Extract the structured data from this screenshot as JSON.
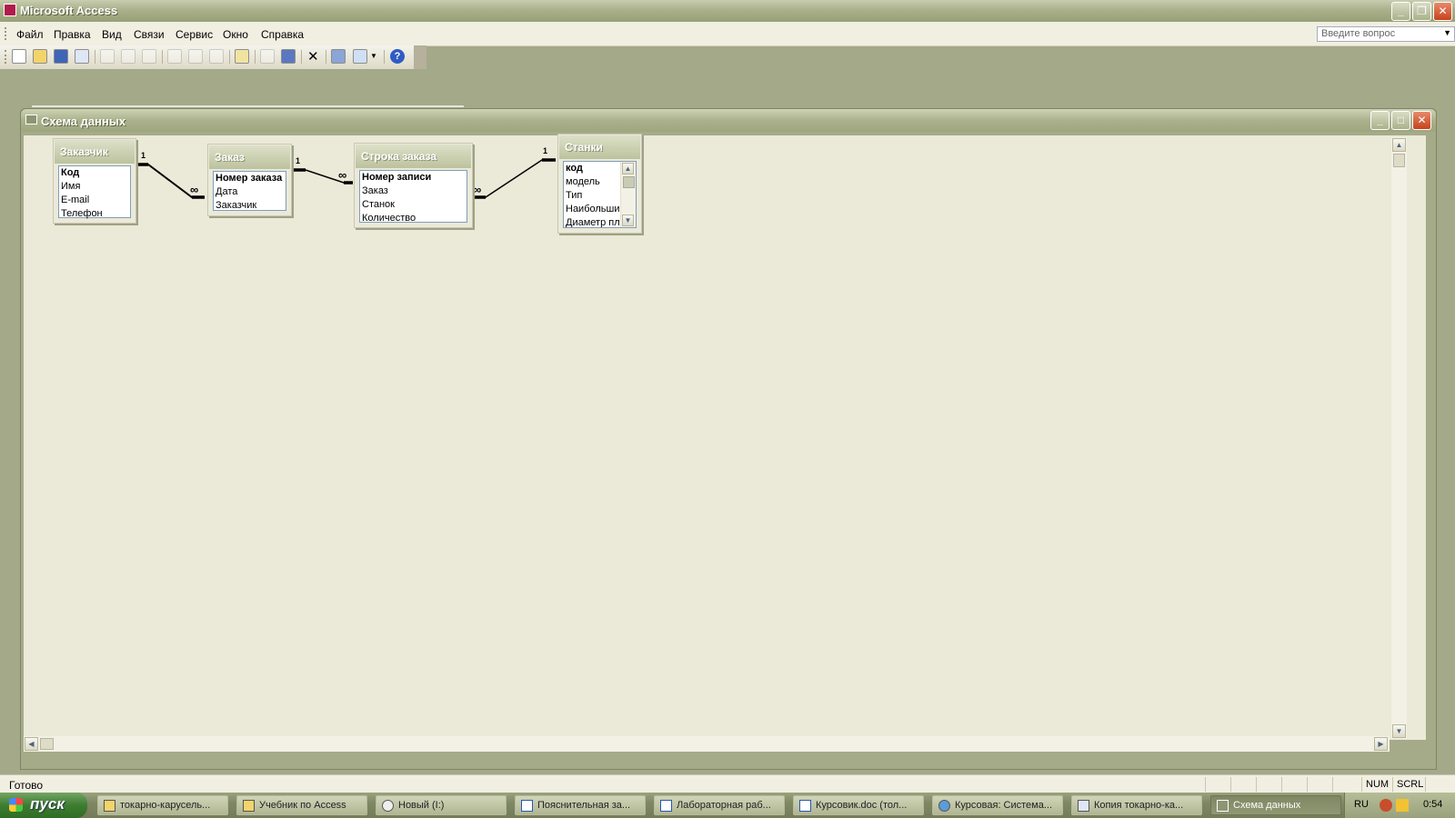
{
  "app": {
    "title": "Microsoft Access"
  },
  "menu": [
    "Файл",
    "Правка",
    "Вид",
    "Связи",
    "Сервис",
    "Окно",
    "Справка"
  ],
  "help_box": {
    "placeholder": "Введите вопрос"
  },
  "toolbar_icons": [
    "new-icon",
    "open-icon",
    "save-icon",
    "print-preview-icon",
    "print-icon",
    "preview-icon",
    "spelling-icon",
    "cut-icon",
    "copy-icon",
    "paste-icon",
    "show-table-icon",
    "direct-relationships-icon",
    "all-relationships-icon",
    "delete-icon",
    "database-window-icon",
    "new-object-icon",
    "help-icon"
  ],
  "window": {
    "title": "Схема данных"
  },
  "tables": [
    {
      "name": "Заказчик",
      "fields": [
        "Код",
        "Имя",
        "E-mail",
        "Телефон"
      ],
      "keys": [
        0
      ]
    },
    {
      "name": "Заказ",
      "fields": [
        "Номер заказа",
        "Дата",
        "Заказчик"
      ],
      "keys": [
        0
      ]
    },
    {
      "name": "Строка заказа",
      "fields": [
        "Номер записи",
        "Заказ",
        "Станок",
        "Количество"
      ],
      "keys": [
        0
      ]
    },
    {
      "name": "Станки",
      "fields": [
        "код",
        "модель",
        "Тип",
        "Наибольший",
        "Диаметр пла"
      ],
      "keys": [
        0
      ]
    }
  ],
  "relations": [
    {
      "one": "1",
      "many": "∞"
    },
    {
      "one": "1",
      "many": "∞"
    },
    {
      "one": "1",
      "many": "∞"
    }
  ],
  "status": {
    "text": "Готово",
    "num": "NUM",
    "scrl": "SCRL"
  },
  "taskbar": {
    "start": "пуск",
    "tasks": [
      "токарно-карусель...",
      "Учебник по Access",
      "Новый (I:)",
      "Пояснительная за...",
      "Лабораторная раб...",
      "Курсовик.doc (тол...",
      "Курсовая: Система...",
      "Копия токарно-ка...",
      "Схема данных"
    ],
    "lang": "RU",
    "clock": "0:54"
  }
}
